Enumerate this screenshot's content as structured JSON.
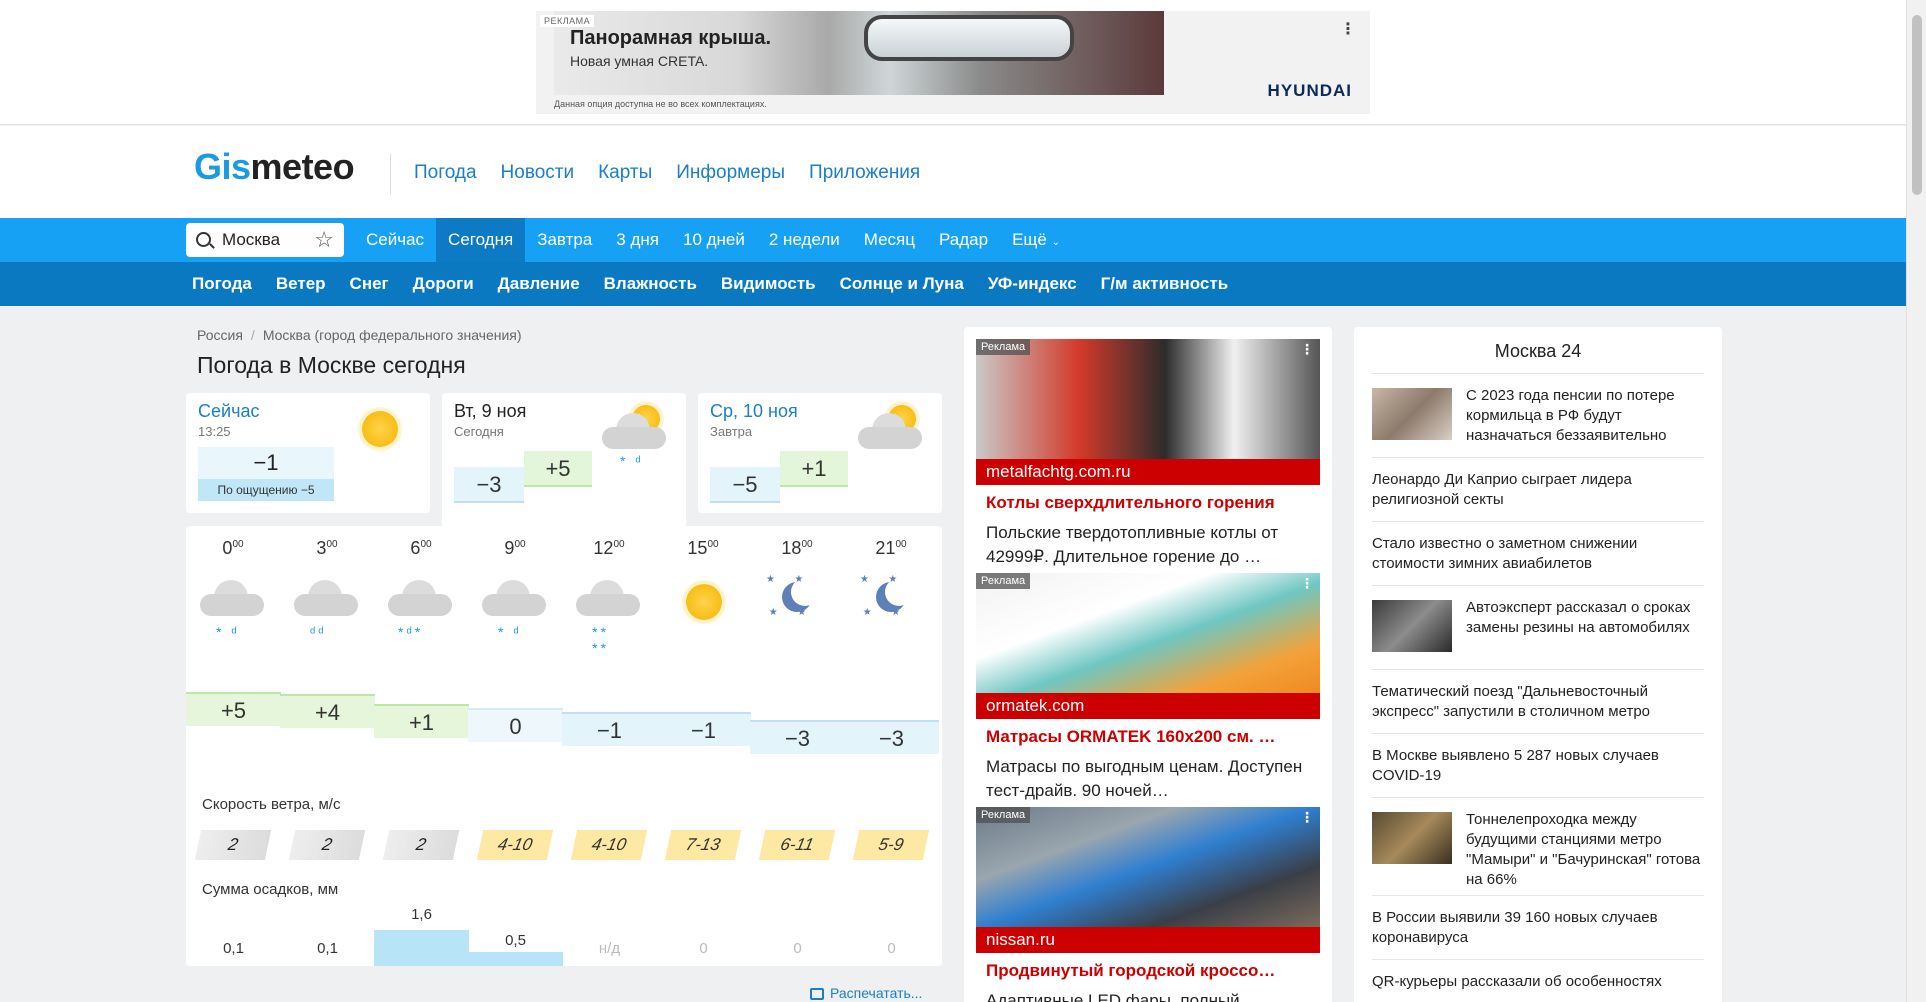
{
  "ad_top": {
    "tag": "РЕКЛАМА",
    "title": "Панорамная крыша.",
    "subtitle": "Новая умная CRETA.",
    "footnote": "Данная опция доступна не во всех комплектациях.",
    "brand": "HYUNDAI"
  },
  "header": {
    "logo_a": "Gis",
    "logo_b": "meteo",
    "nav": [
      "Погода",
      "Новости",
      "Карты",
      "Информеры",
      "Приложения"
    ]
  },
  "search": {
    "value": "Москва"
  },
  "tabs1": [
    "Сейчас",
    "Сегодня",
    "Завтра",
    "3 дня",
    "10 дней",
    "2 недели",
    "Месяц",
    "Радар",
    "Ещё"
  ],
  "tabs2": [
    "Погода",
    "Ветер",
    "Снег",
    "Дороги",
    "Давление",
    "Влажность",
    "Видимость",
    "Солнце и Луна",
    "УФ-индекс",
    "Г/м активность"
  ],
  "breadcrumb": {
    "a": "Россия",
    "sep": "/",
    "b": "Москва (город федерального значения)"
  },
  "page_title": "Погода в Москве сегодня",
  "now": {
    "label": "Сейчас",
    "time": "13:25",
    "temp": "−1",
    "feel": "По ощущению −5"
  },
  "day1": {
    "date": "Вт, 9 ноя",
    "sub": "Сегодня",
    "min": "−3",
    "max": "+5"
  },
  "day2": {
    "date": "Ср, 10 ноя",
    "sub": "Завтра",
    "min": "−5",
    "max": "+1"
  },
  "hourly": {
    "hours": [
      "0",
      "3",
      "6",
      "9",
      "12",
      "15",
      "18",
      "21"
    ],
    "minutes": "00",
    "temps": [
      "+5",
      "+4",
      "+1",
      "0",
      "−1",
      "−1",
      "−3",
      "−3"
    ],
    "wind_label": "Скорость ветра, м/с",
    "wind": [
      "2",
      "2",
      "2",
      "4-10",
      "4-10",
      "7-13",
      "6-11",
      "5-9"
    ],
    "precip_label": "Сумма осадков, мм",
    "precip": [
      "0,1",
      "0,1",
      "1,6",
      "0,5",
      "н/д",
      "0",
      "0",
      "0"
    ]
  },
  "print_label": "Распечатать...",
  "ads": [
    {
      "tag": "Реклама",
      "domain": "metalfachtg.com.ru",
      "title": "Котлы сверхдлительного горения",
      "text": "Польские твердотопливные котлы от 42999₽. Длительное горение до …"
    },
    {
      "tag": "Реклама",
      "domain": "ormatek.com",
      "title": "Матрасы ORMATEK 160x200 см. …",
      "text": "Матрасы по выгодным ценам. Доступен тест-драйв. 90 ночей…"
    },
    {
      "tag": "Реклама",
      "domain": "nissan.ru",
      "title": "Продвинутый городской кроссо…",
      "text": "Адаптивные LED фары, полный"
    }
  ],
  "news": {
    "title": "Москва 24",
    "items": [
      "С 2023 года пенсии по потере кормильца в РФ будут назначаться беззаявительно",
      "Леонардо Ди Каприо сыграет лидера религиозной секты",
      "Стало известно о заметном снижении стоимости зимних авиабилетов",
      "Автоэксперт рассказал о сроках замены резины на автомобилях",
      "Тематический поезд \"Дальневосточный экспресс\" запустили в столичном метро",
      "В Москве выявлено 5 287 новых случаев COVID-19",
      "Тоннелепроходка между будущими станциями метро \"Мамыри\" и \"Бачуринская\" готова на 66%",
      "В России выявили 39 160 новых случаев коронавируса",
      "QR-курьеры рассказали об особенностях"
    ]
  }
}
